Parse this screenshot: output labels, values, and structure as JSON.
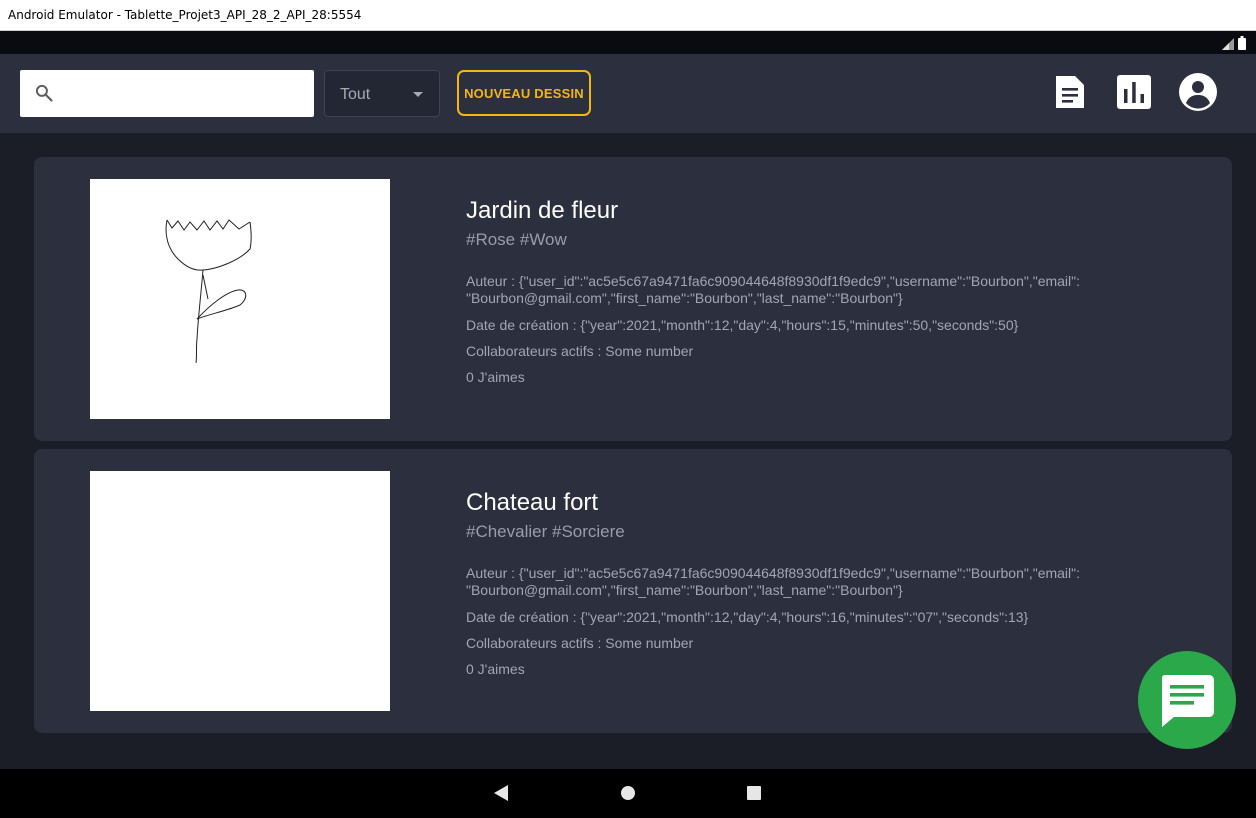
{
  "window": {
    "title": "Android Emulator - Tablette_Projet3_API_28_2_API_28:5554"
  },
  "toolbar": {
    "search_placeholder": "",
    "filter_value": "Tout",
    "new_button_label": "NOUVEAU DESSIN"
  },
  "colors": {
    "accent": "#f2b716",
    "fab": "#2aa84a",
    "card_bg": "#2b2f3e",
    "page_bg": "#1b1e27"
  },
  "cards": [
    {
      "title": "Jardin de fleur",
      "tags": "#Rose #Wow",
      "author": "Auteur : {\"user_id\":\"ac5e5c67a9471fa6c909044648f8930df1f9edc9\",\"username\":\"Bourbon\",\"email\": \"Bourbon@gmail.com\",\"first_name\":\"Bourbon\",\"last_name\":\"Bourbon\"}",
      "date": "Date de création : {\"year\":2021,\"month\":12,\"day\":4,\"hours\":15,\"minutes\":50,\"seconds\":50}",
      "collaborators": "Collaborateurs actifs : Some number",
      "likes": "0 J'aimes"
    },
    {
      "title": "Chateau fort",
      "tags": "#Chevalier #Sorciere",
      "author": "Auteur : {\"user_id\":\"ac5e5c67a9471fa6c909044648f8930df1f9edc9\",\"username\":\"Bourbon\",\"email\": \"Bourbon@gmail.com\",\"first_name\":\"Bourbon\",\"last_name\":\"Bourbon\"}",
      "date": "Date de création : {\"year\":2021,\"month\":12,\"day\":4,\"hours\":16,\"minutes\":\"07\",\"seconds\":13}",
      "collaborators": "Collaborateurs actifs : Some number",
      "likes": "0 J'aimes"
    }
  ]
}
